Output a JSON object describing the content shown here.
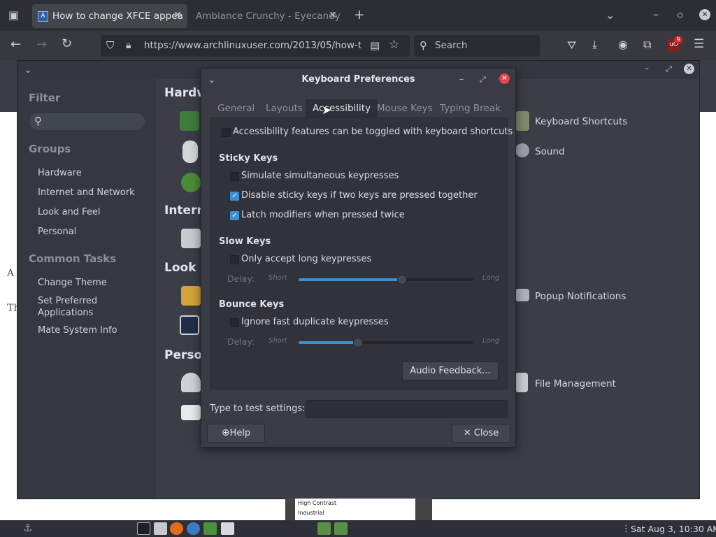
{
  "browser": {
    "tabs": [
      {
        "label": "How to change XFCE appea",
        "active": true
      },
      {
        "label": "Ambiance Crunchy - Eyecandy",
        "active": false
      }
    ],
    "new_tab_icon": "plus-icon",
    "url": "https://www.archlinuxuser.com/2013/05/how-to-",
    "search_placeholder": "Search",
    "extension_badge": "9"
  },
  "settings": {
    "filter_heading": "Filter",
    "groups_heading": "Groups",
    "groups": [
      "Hardware",
      "Internet and Network",
      "Look and Feel",
      "Personal"
    ],
    "tasks_heading": "Common Tasks",
    "tasks": [
      "Change Theme",
      "Set Preferred Applications",
      "Mate System Info"
    ],
    "sections": [
      "Hardw",
      "Intern",
      "Look a",
      "Perso"
    ],
    "items": [
      "Keyboard Shortcuts",
      "Sound",
      "Popup Notifications",
      "File Management"
    ]
  },
  "dialog": {
    "title": "Keyboard Preferences",
    "tabs": [
      "General",
      "Layouts",
      "Accessibility",
      "Mouse Keys",
      "Typing Break"
    ],
    "active_tab": "Accessibility",
    "toggle_label": "Accessibility features can be toggled with keyboard shortcuts",
    "sticky": {
      "heading": "Sticky Keys",
      "opt1": "Simulate simultaneous keypresses",
      "opt2": "Disable sticky keys if two keys are pressed together",
      "opt3": "Latch modifiers when pressed twice"
    },
    "slow": {
      "heading": "Slow Keys",
      "opt1": "Only accept long keypresses",
      "delay_label": "Delay:",
      "short_label": "Short",
      "long_label": "Long",
      "delay_value": 0.59
    },
    "bounce": {
      "heading": "Bounce Keys",
      "opt1": "Ignore fast duplicate keypresses",
      "delay_label": "Delay:",
      "short_label": "Short",
      "long_label": "Long",
      "delay_value": 0.34
    },
    "audio_button": "Audio Feedback...",
    "test_label": "Type to test settings:",
    "help_button": "Help",
    "close_button": "Close"
  },
  "page": {
    "fragment_a": "A",
    "fragment_t": "Th",
    "list_line1": "High Contrast",
    "list_line2": "Industrial"
  },
  "taskbar": {
    "clock": "Sat Aug  3, 10:30 AM"
  },
  "colors": {
    "accent": "#3d8fd1",
    "close_red": "#e0484b"
  }
}
